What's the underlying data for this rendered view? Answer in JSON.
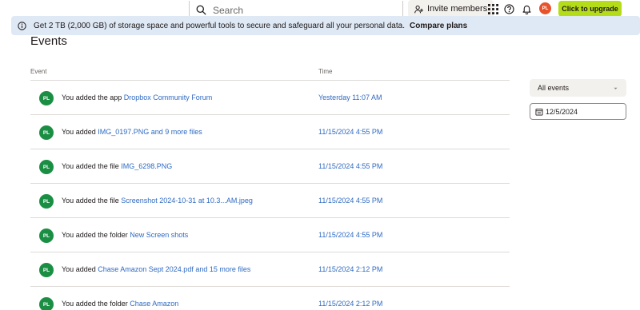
{
  "header": {
    "search_placeholder": "Search",
    "invite_label": "Invite members",
    "avatar_initials": "PL",
    "upgrade_label": "Click to upgrade"
  },
  "banner": {
    "text": "Get 2 TB (2,000 GB) of storage space and powerful tools to secure and safeguard all your personal data.",
    "link": "Compare plans"
  },
  "page": {
    "title": "Events"
  },
  "table": {
    "col_event": "Event",
    "col_time": "Time",
    "rows": [
      {
        "avatar": "PL",
        "prefix": "You added the app",
        "link": "Dropbox Community Forum",
        "time": "Yesterday 11:07 AM"
      },
      {
        "avatar": "PL",
        "prefix": "You added",
        "link": "IMG_0197.PNG and 9 more files",
        "time": "11/15/2024 4:55 PM"
      },
      {
        "avatar": "PL",
        "prefix": "You added the file",
        "link": "IMG_6298.PNG",
        "time": "11/15/2024 4:55 PM"
      },
      {
        "avatar": "PL",
        "prefix": "You added the file",
        "link": "Screenshot 2024-10-31 at 10.3...AM.jpeg",
        "time": "11/15/2024 4:55 PM"
      },
      {
        "avatar": "PL",
        "prefix": "You added the folder",
        "link": "New Screen shots",
        "time": "11/15/2024 4:55 PM"
      },
      {
        "avatar": "PL",
        "prefix": "You added",
        "link": "Chase Amazon Sept 2024.pdf and 15 more files",
        "time": "11/15/2024 2:12 PM"
      },
      {
        "avatar": "PL",
        "prefix": "You added the folder",
        "link": "Chase Amazon",
        "time": "11/15/2024 2:12 PM"
      }
    ]
  },
  "filters": {
    "event_filter": "All events",
    "date": "12/5/2024"
  },
  "colors": {
    "accent": "#2f6ac2",
    "upgrade": "#b4dc19",
    "avatar_green": "#1a8f44",
    "avatar_orange": "#e8532b",
    "banner_bg": "#dfe9f5"
  }
}
